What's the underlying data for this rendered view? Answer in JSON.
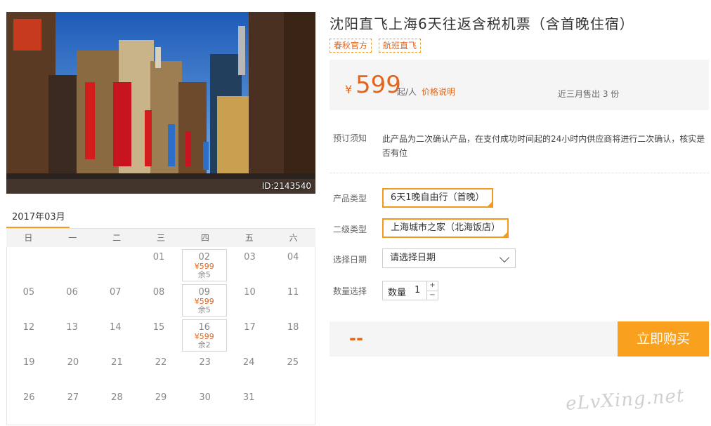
{
  "photo": {
    "id_text": "ID:2143540"
  },
  "title": "沈阳直飞上海6天往返含税机票（含首晚住宿）",
  "tags": [
    "春秋官方",
    "航班直飞"
  ],
  "price": {
    "yen": "¥",
    "amount": "599",
    "unit": "起/人",
    "link": "价格说明",
    "sold": "近三月售出 3 份"
  },
  "notice": {
    "label": "预订须知",
    "text": "此产品为二次确认产品，在支付成功时间起的24小时内供应商将进行二次确认，核实是否有位"
  },
  "options": {
    "product_type_label": "产品类型",
    "product_type_value": "6天1晚自由行（首晚）",
    "sub_type_label": "二级类型",
    "sub_type_value": "上海城市之家（北海饭店）",
    "date_label": "选择日期",
    "date_placeholder": "请选择日期",
    "qty_label_row": "数量选择",
    "qty_label": "数量",
    "qty_value": "1",
    "qty_plus": "+",
    "qty_minus": "−"
  },
  "buy": {
    "total": "--",
    "button": "立即购买"
  },
  "calendar": {
    "month": "2017年03月",
    "weekdays": [
      "日",
      "一",
      "二",
      "三",
      "四",
      "五",
      "六"
    ],
    "weeks": [
      [
        {
          "d": ""
        },
        {
          "d": ""
        },
        {
          "d": ""
        },
        {
          "d": "01"
        },
        {
          "d": "02",
          "price": "¥599",
          "stock": "余5"
        },
        {
          "d": "03"
        },
        {
          "d": "04"
        }
      ],
      [
        {
          "d": "05"
        },
        {
          "d": "06"
        },
        {
          "d": "07"
        },
        {
          "d": "08"
        },
        {
          "d": "09",
          "price": "¥599",
          "stock": "余5"
        },
        {
          "d": "10"
        },
        {
          "d": "11"
        }
      ],
      [
        {
          "d": "12"
        },
        {
          "d": "13"
        },
        {
          "d": "14"
        },
        {
          "d": "15"
        },
        {
          "d": "16",
          "price": "¥599",
          "stock": "余2"
        },
        {
          "d": "17"
        },
        {
          "d": "18"
        }
      ],
      [
        {
          "d": "19"
        },
        {
          "d": "20"
        },
        {
          "d": "21"
        },
        {
          "d": "22"
        },
        {
          "d": "23"
        },
        {
          "d": "24"
        },
        {
          "d": "25"
        }
      ],
      [
        {
          "d": "26"
        },
        {
          "d": "27"
        },
        {
          "d": "28"
        },
        {
          "d": "29"
        },
        {
          "d": "30"
        },
        {
          "d": "31"
        },
        {
          "d": ""
        }
      ]
    ]
  },
  "watermark": "eLvXing.net",
  "colors": {
    "accent": "#f39a1d",
    "price": "#e4661c",
    "buy_button": "#f9a01e"
  }
}
